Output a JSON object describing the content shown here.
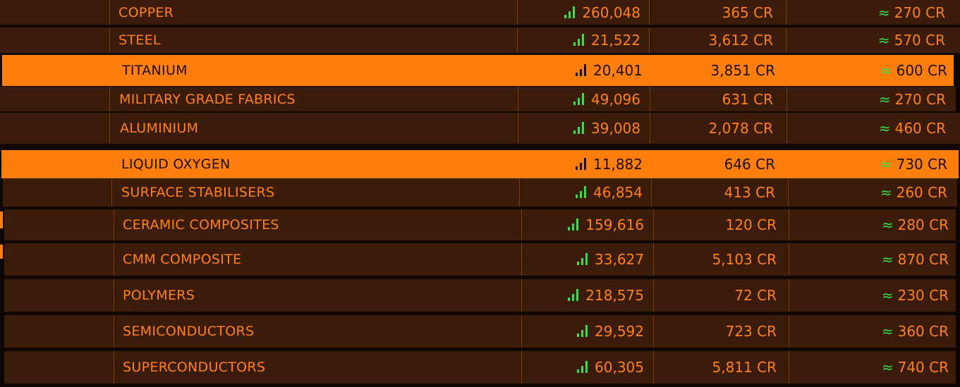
{
  "colors": {
    "accent": "#ff7f0e",
    "row_background": "#3b1c0a",
    "text": "#ff8019",
    "supply_indicator": "#36e046"
  },
  "commodities": [
    {
      "name": "COPPER",
      "supply": "260,048",
      "price": "365 CR",
      "profit": "≈ 270 CR",
      "selected": false
    },
    {
      "name": "STEEL",
      "supply": "21,522",
      "price": "3,612 CR",
      "profit": "≈ 570 CR",
      "selected": false
    },
    {
      "name": "TITANIUM",
      "supply": "20,401",
      "price": "3,851 CR",
      "profit": "≈ 600 CR",
      "selected": true
    },
    {
      "name": "MILITARY GRADE FABRICS",
      "supply": "49,096",
      "price": "631 CR",
      "profit": "≈ 270 CR",
      "selected": false
    },
    {
      "name": "ALUMINIUM",
      "supply": "39,008",
      "price": "2,078 CR",
      "profit": "≈ 460 CR",
      "selected": false
    },
    {
      "name": "LIQUID OXYGEN",
      "supply": "11,882",
      "price": "646 CR",
      "profit": "≈ 730 CR",
      "selected": true
    },
    {
      "name": "SURFACE STABILISERS",
      "supply": "46,854",
      "price": "413 CR",
      "profit": "≈ 260 CR",
      "selected": false
    },
    {
      "name": "CERAMIC COMPOSITES",
      "supply": "159,616",
      "price": "120 CR",
      "profit": "≈ 280 CR",
      "selected": false
    },
    {
      "name": "CMM COMPOSITE",
      "supply": "33,627",
      "price": "5,103 CR",
      "profit": "≈ 870 CR",
      "selected": false
    },
    {
      "name": "POLYMERS",
      "supply": "218,575",
      "price": "72 CR",
      "profit": "≈ 230 CR",
      "selected": false
    },
    {
      "name": "SEMICONDUCTORS",
      "supply": "29,592",
      "price": "723 CR",
      "profit": "≈ 360 CR",
      "selected": false
    },
    {
      "name": "SUPERCONDUCTORS",
      "supply": "60,305",
      "price": "5,811 CR",
      "profit": "≈ 740 CR",
      "selected": false
    }
  ]
}
